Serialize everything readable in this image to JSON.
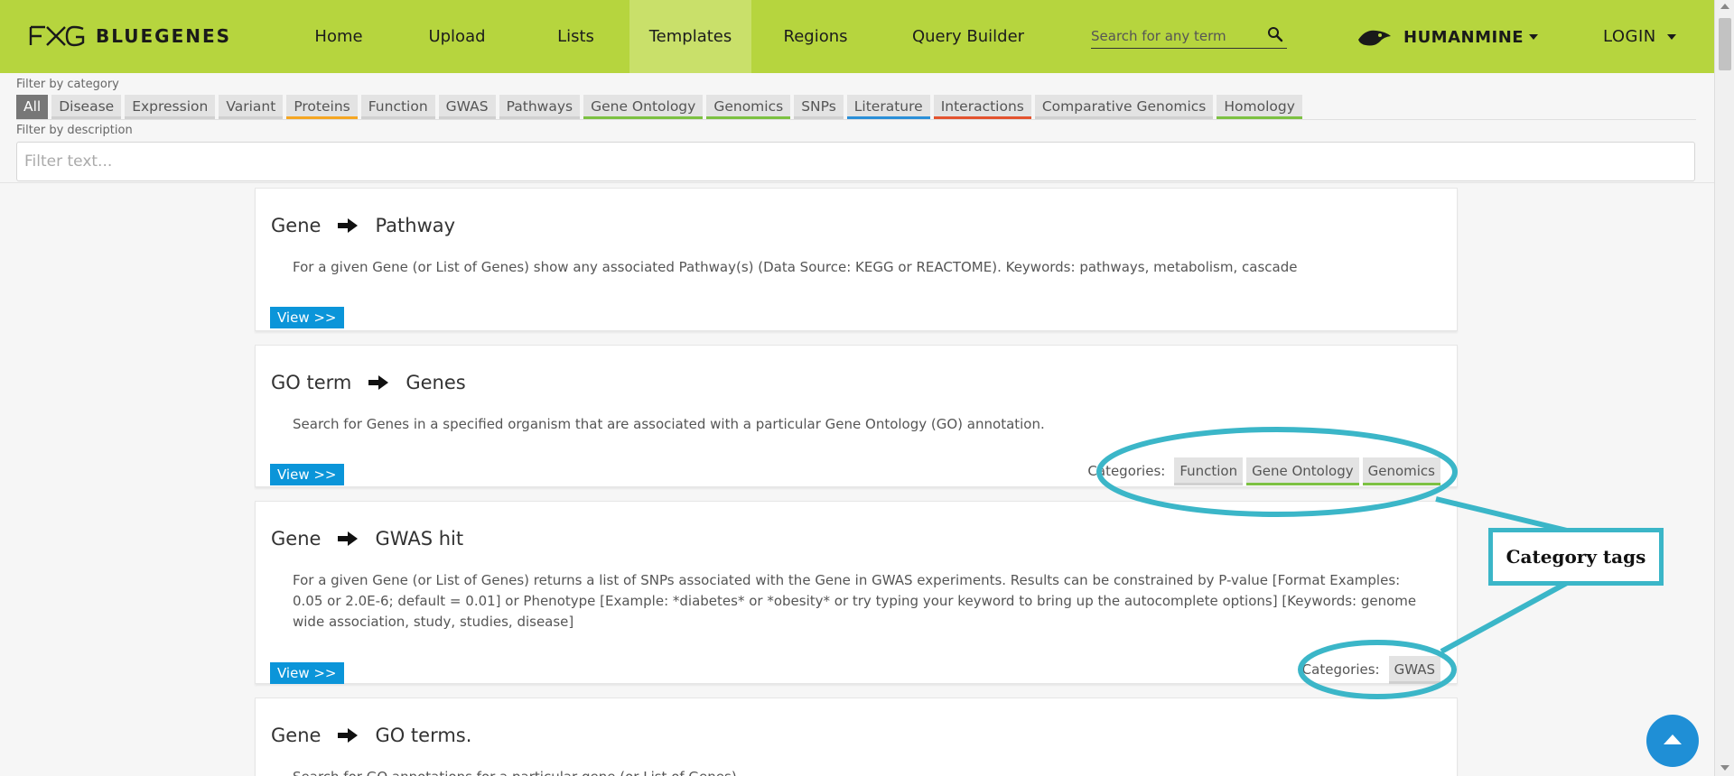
{
  "navbar": {
    "brand": "BLUEGENES",
    "items": [
      {
        "label": "Home"
      },
      {
        "label": "Upload"
      },
      {
        "label": "Lists"
      },
      {
        "label": "Templates"
      },
      {
        "label": "Regions"
      },
      {
        "label": "Query Builder"
      }
    ],
    "active_item": "Templates",
    "search_placeholder": "Search for any term",
    "mine_name": "HUMANMINE",
    "login_label": "LOGIN",
    "bg_color": "#b6d53e",
    "active_bg_color": "#c9e06a"
  },
  "filters": {
    "category_label": "Filter by category",
    "categories": [
      {
        "label": "All",
        "accent": "#777777"
      },
      {
        "label": "Disease",
        "accent": "#d0d0d0"
      },
      {
        "label": "Expression",
        "accent": "#d0d0d0"
      },
      {
        "label": "Variant",
        "accent": "#d0d0d0"
      },
      {
        "label": "Proteins",
        "accent": "#f5a623"
      },
      {
        "label": "Function",
        "accent": "#d0d0d0"
      },
      {
        "label": "GWAS",
        "accent": "#d0d0d0"
      },
      {
        "label": "Pathways",
        "accent": "#d0d0d0"
      },
      {
        "label": "Gene Ontology",
        "accent": "#7cc142"
      },
      {
        "label": "Genomics",
        "accent": "#7cc142"
      },
      {
        "label": "SNPs",
        "accent": "#d0d0d0"
      },
      {
        "label": "Literature",
        "accent": "#2a8fd8"
      },
      {
        "label": "Interactions",
        "accent": "#e3532f"
      },
      {
        "label": "Comparative Genomics",
        "accent": "#d0d0d0"
      },
      {
        "label": "Homology",
        "accent": "#7cc142"
      }
    ],
    "active_category": "All",
    "description_label": "Filter by description",
    "description_placeholder": "Filter text..."
  },
  "templates": [
    {
      "from": "Gene",
      "to": "Pathway",
      "description": "For a given Gene (or List of Genes) show any associated Pathway(s) (Data Source: KEGG or REACTOME). Keywords: pathways, metabolism, cascade",
      "view_label": "View >>",
      "categories_label": "",
      "categories": []
    },
    {
      "from": "GO term",
      "to": "Genes",
      "description": "Search for Genes in a specified organism that are associated with a particular Gene Ontology (GO) annotation.",
      "view_label": "View >>",
      "categories_label": "Categories:",
      "categories": [
        {
          "label": "Function",
          "accent": "#d0d0d0"
        },
        {
          "label": "Gene Ontology",
          "accent": "#7cc142"
        },
        {
          "label": "Genomics",
          "accent": "#7cc142"
        }
      ]
    },
    {
      "from": "Gene",
      "to": "GWAS hit",
      "description": "For a given Gene (or List of Genes) returns a list of SNPs associated with the Gene in GWAS experiments. Results can be constrained by P-value [Format Examples: 0.05 or 2.0E-6; default = 0.01] or Phenotype [Example: *diabetes* or *obesity* or try typing your keyword to bring up the autocomplete options] [Keywords: genome wide association, study, studies, disease]",
      "view_label": "View >>",
      "categories_label": "Categories:",
      "categories": [
        {
          "label": "GWAS",
          "accent": "#d0d0d0"
        }
      ]
    },
    {
      "from": "Gene",
      "to": "GO terms.",
      "description": "Search for GO annotations for a particular gene (or List of Genes).",
      "view_label": "",
      "categories_label": "",
      "categories": []
    }
  ],
  "annotation": {
    "label": "Category tags",
    "color": "#3bb6c8"
  },
  "icons": {
    "brand_logo": "fxg-logo-icon",
    "search": "search-icon",
    "mine_logo": "humanmine-logo-icon",
    "arrow": "arrow-right-icon",
    "back_to_top": "chevron-up-icon"
  }
}
